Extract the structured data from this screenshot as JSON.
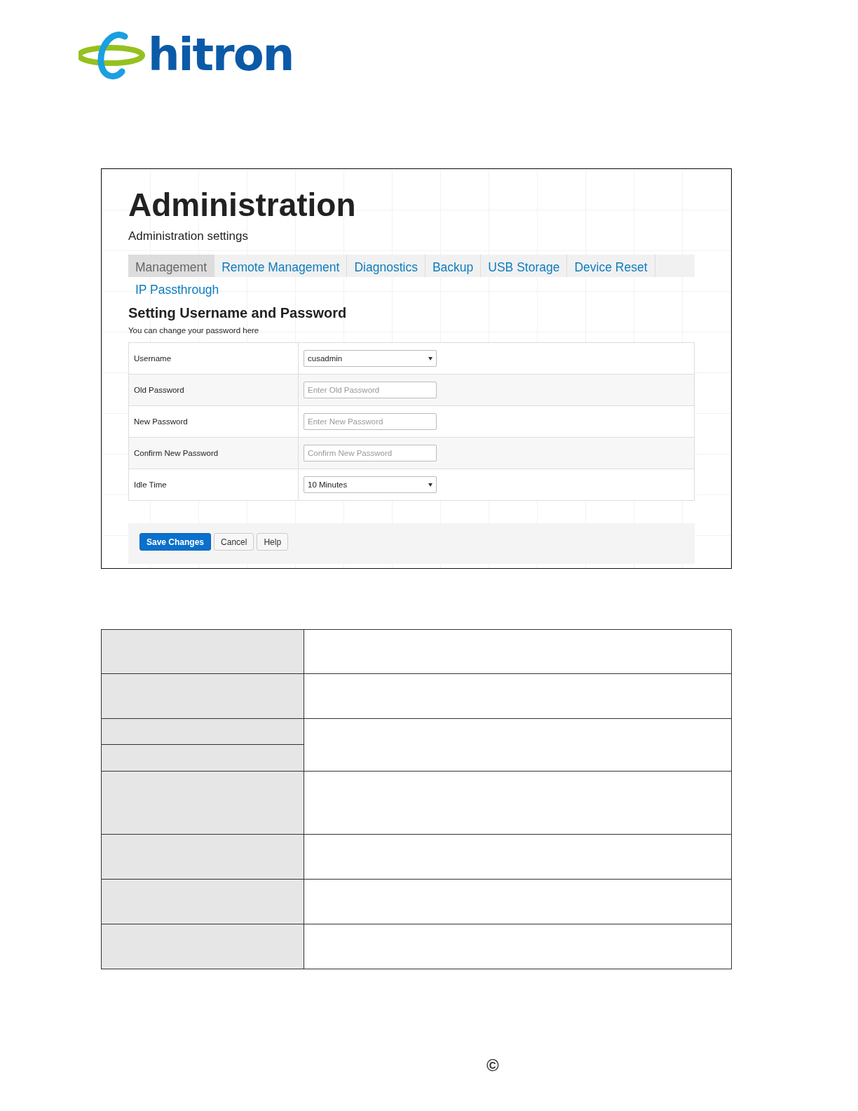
{
  "logo": {
    "text": "hitron"
  },
  "screenshot": {
    "title": "Administration",
    "subtitle": "Administration settings",
    "tabs": [
      {
        "label": "Management",
        "selected": true
      },
      {
        "label": "Remote Management",
        "selected": false
      },
      {
        "label": "Diagnostics",
        "selected": false
      },
      {
        "label": "Backup",
        "selected": false
      },
      {
        "label": "USB Storage",
        "selected": false
      },
      {
        "label": "Device Reset",
        "selected": false
      },
      {
        "label": "IP Passthrough",
        "selected": false
      }
    ],
    "section_title": "Setting Username and Password",
    "section_note": "You can change your password here",
    "fields": [
      {
        "label": "Username",
        "kind": "select",
        "value": "cusadmin"
      },
      {
        "label": "Old Password",
        "kind": "input",
        "placeholder": "Enter Old Password"
      },
      {
        "label": "New Password",
        "kind": "input",
        "placeholder": "Enter New Password"
      },
      {
        "label": "Confirm New Password",
        "kind": "input",
        "placeholder": "Confirm New Password"
      },
      {
        "label": "Idle Time",
        "kind": "select",
        "value": "10 Minutes"
      }
    ],
    "buttons": [
      {
        "label": "Save Changes",
        "kind": "primary"
      },
      {
        "label": "Cancel",
        "kind": "default"
      },
      {
        "label": "Help",
        "kind": "default"
      }
    ]
  },
  "footer": {
    "symbol": "©"
  }
}
